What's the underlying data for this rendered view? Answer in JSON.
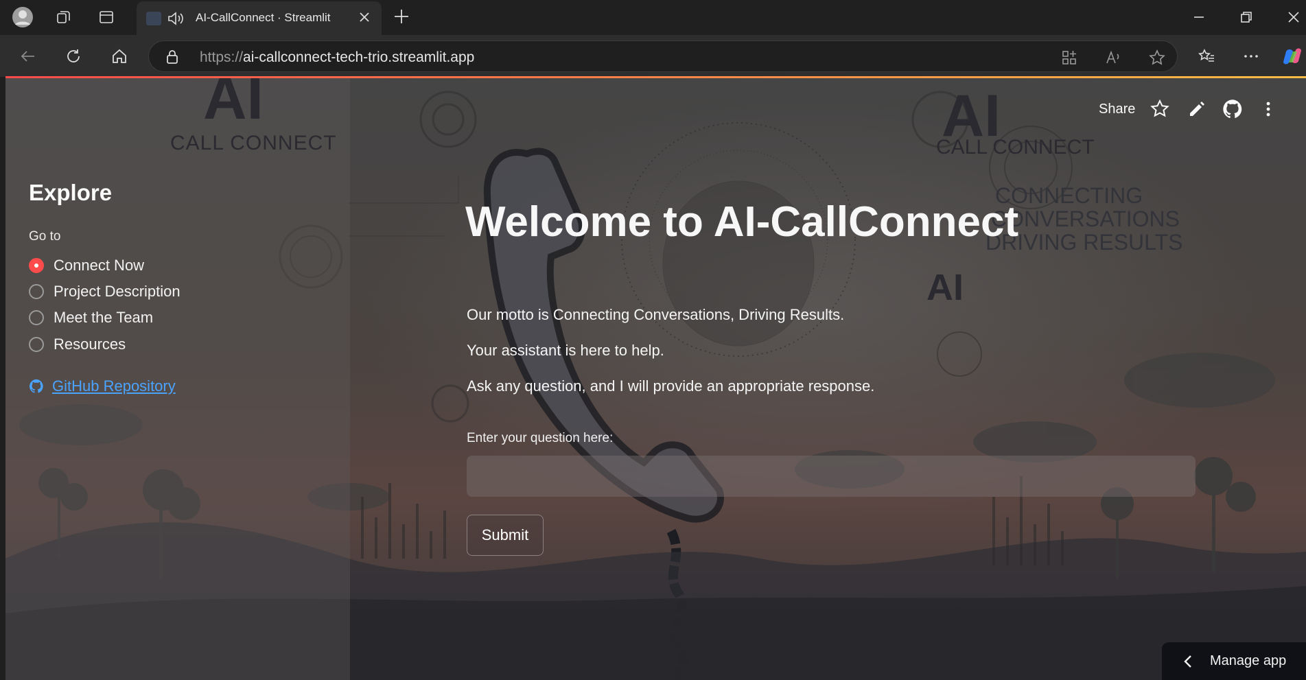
{
  "browser": {
    "tab": {
      "title": "AI-CallConnect · Streamlit"
    },
    "address": {
      "protocol": "https://",
      "host": "ai-callconnect-tech-trio.streamlit.app"
    }
  },
  "app": {
    "header": {
      "share_label": "Share"
    },
    "sidebar": {
      "logo_ai": "AI",
      "logo_text": "CALL CONNECT",
      "title": "Explore",
      "goto_label": "Go to",
      "options": [
        {
          "label": "Connect Now",
          "selected": true
        },
        {
          "label": "Project Description",
          "selected": false
        },
        {
          "label": "Meet the Team",
          "selected": false
        },
        {
          "label": "Resources",
          "selected": false
        }
      ],
      "github_link": "GitHub Repository"
    },
    "main": {
      "title": "Welcome to AI-CallConnect",
      "paragraphs": [
        "Our motto is Connecting Conversations, Driving Results.",
        "Your assistant is here to help.",
        "Ask any question, and I will provide an appropriate response."
      ],
      "question_label": "Enter your question here:",
      "question_value": "",
      "submit_label": "Submit"
    },
    "background": {
      "logo_ai": "AI",
      "logo_text": "CALL CONNECT",
      "tagline": [
        "CONNECTING",
        "CONVERSATIONS",
        "DRIVING RESULTS"
      ],
      "ai_mark": "AI"
    },
    "manage_app": "Manage app"
  },
  "colors": {
    "accent": "#ff4b4b",
    "link": "#4aa3ff"
  }
}
